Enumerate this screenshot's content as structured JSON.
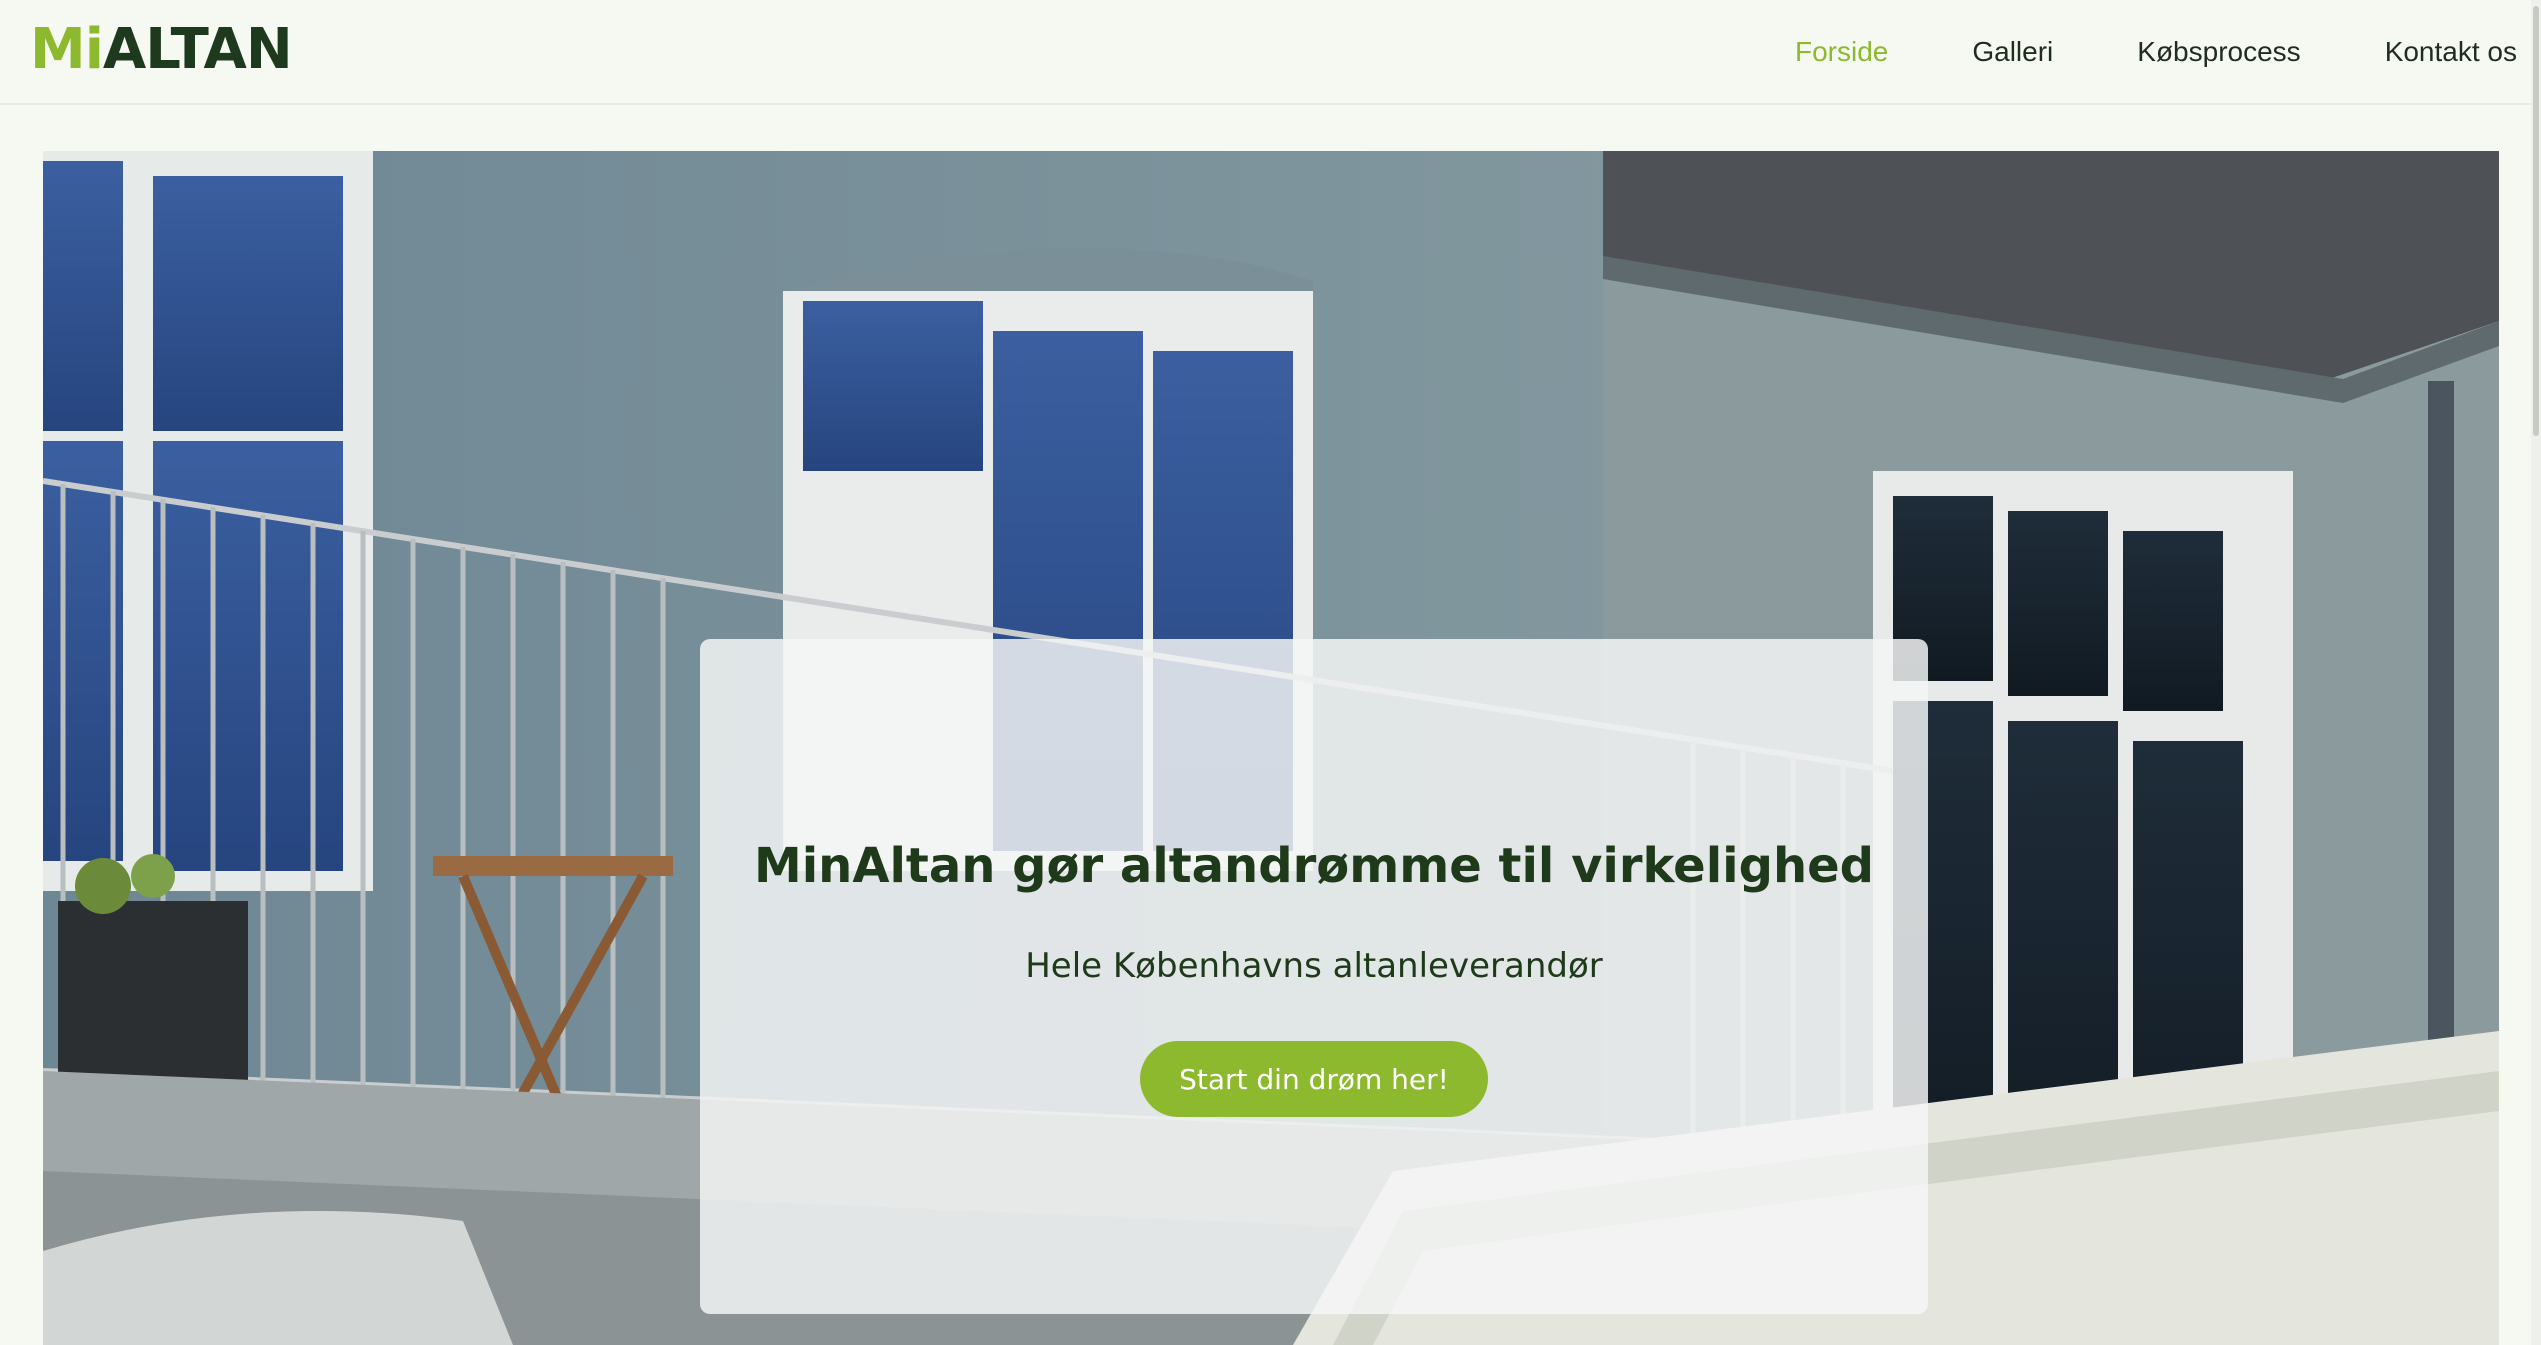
{
  "brand": {
    "logo_mi": "Mi",
    "logo_altan": "ALTAN"
  },
  "nav": {
    "items": [
      {
        "label": "Forside",
        "active": true
      },
      {
        "label": "Galleri",
        "active": false
      },
      {
        "label": "Købsprocess",
        "active": false
      },
      {
        "label": "Kontakt os",
        "active": false
      }
    ]
  },
  "hero": {
    "title": "MinAltan gør altandrømme til virkelighed",
    "subtitle": "Hele Københavns altanleverandør",
    "cta_label": "Start din drøm her!"
  },
  "colors": {
    "accent": "#8db92e",
    "brand_dark": "#1e3a1e",
    "background": "#f6f8f2"
  }
}
